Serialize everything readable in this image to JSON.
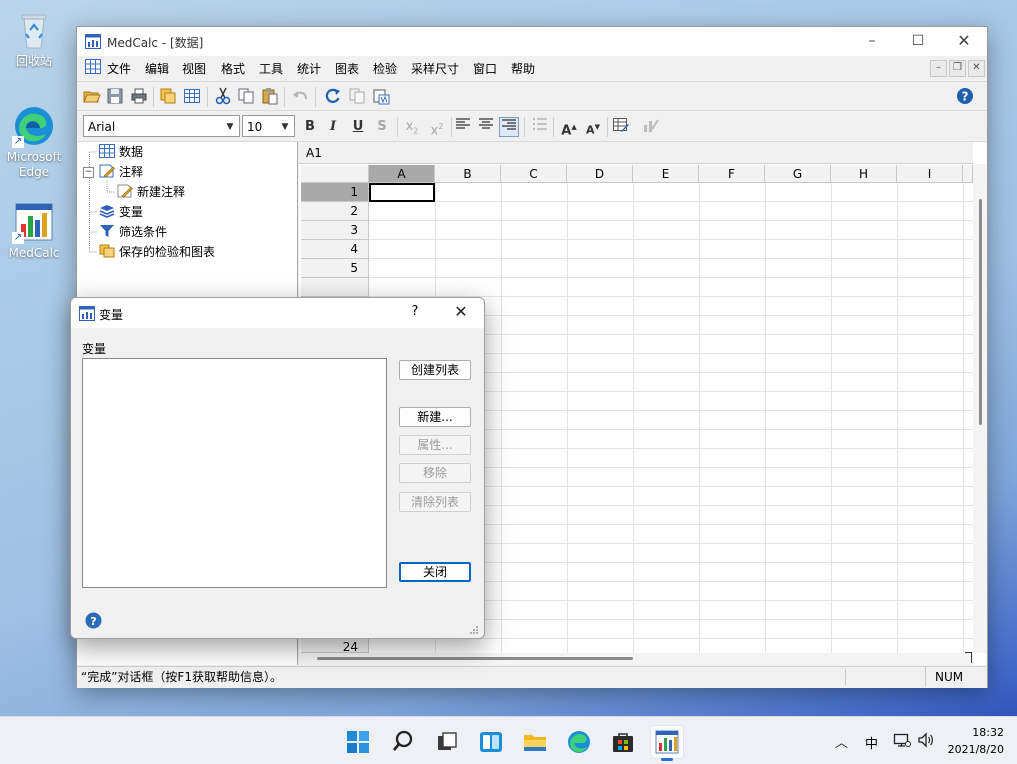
{
  "desktop": {
    "icons": [
      {
        "label": "回收站"
      },
      {
        "label": "Microsoft Edge"
      },
      {
        "label": "MedCalc"
      }
    ]
  },
  "window": {
    "title": "MedCalc - [数据]",
    "menu": [
      "文件",
      "编辑",
      "视图",
      "格式",
      "工具",
      "统计",
      "图表",
      "检验",
      "采样尺寸",
      "窗口",
      "帮助"
    ],
    "font_name": "Arial",
    "font_size": "10",
    "format_buttons": [
      "B",
      "I",
      "U",
      "S"
    ],
    "tree": [
      {
        "label": "数据"
      },
      {
        "label": "注释"
      },
      {
        "label": "新建注释"
      },
      {
        "label": "变量"
      },
      {
        "label": "筛选条件"
      },
      {
        "label": "保存的检验和图表"
      }
    ],
    "cell_ref": "A1",
    "columns": [
      "A",
      "B",
      "C",
      "D",
      "E",
      "F",
      "G",
      "H",
      "I"
    ],
    "rows": [
      "1",
      "2",
      "3",
      "4",
      "5",
      "24"
    ],
    "status_text": "“完成”对话框（按F1获取帮助信息）。",
    "status_num": "NUM"
  },
  "dialog": {
    "title": "变量",
    "help_glyph": "?",
    "list_label": "变量",
    "buttons": {
      "create_list": "创建列表",
      "new": "新建...",
      "properties": "属性...",
      "remove": "移除",
      "clear_list": "清除列表",
      "close": "关闭"
    }
  },
  "taskbar": {
    "ime": "中",
    "time": "18:32",
    "date": "2021/8/20"
  },
  "colors": {
    "accent": "#0067c0",
    "selected_header": "#a9a9a9",
    "help_blue": "#2b6cb8"
  }
}
